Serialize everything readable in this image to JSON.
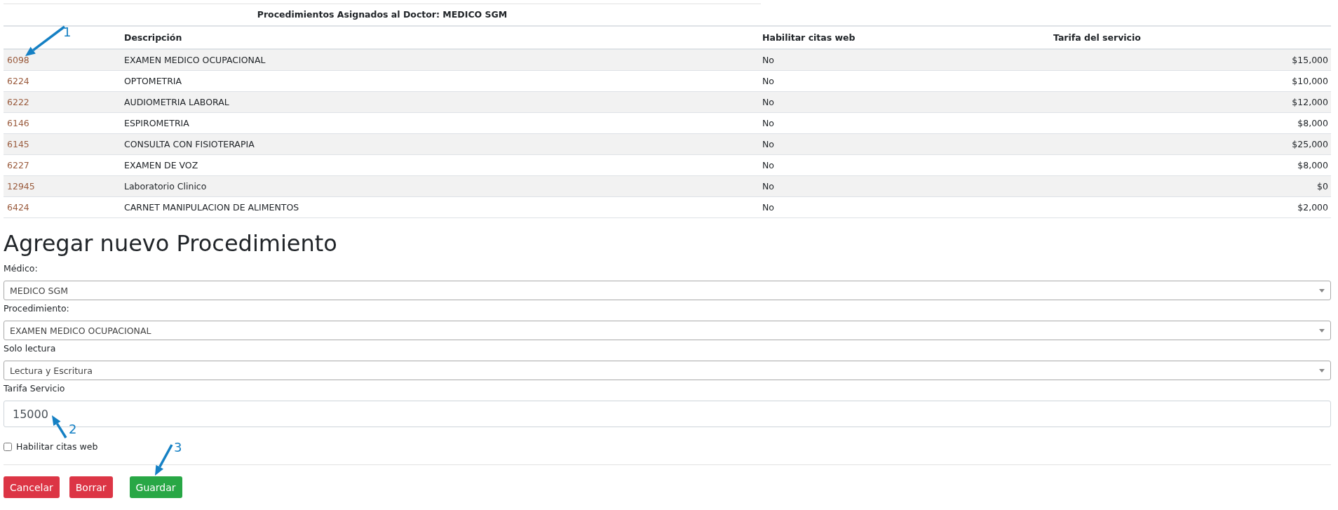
{
  "table": {
    "title": "Procedimientos Asignados al Doctor: MEDICO SGM",
    "columns": [
      "Descripción",
      "Habilitar citas web",
      "Tarifa del servicio"
    ],
    "rows": [
      {
        "code": "6098",
        "description": "EXAMEN MEDICO OCUPACIONAL",
        "web": "No",
        "fee": "$15,000"
      },
      {
        "code": "6224",
        "description": "OPTOMETRIA",
        "web": "No",
        "fee": "$10,000"
      },
      {
        "code": "6222",
        "description": "AUDIOMETRIA LABORAL",
        "web": "No",
        "fee": "$12,000"
      },
      {
        "code": "6146",
        "description": "ESPIROMETRIA",
        "web": "No",
        "fee": "$8,000"
      },
      {
        "code": "6145",
        "description": "CONSULTA CON FISIOTERAPIA",
        "web": "No",
        "fee": "$25,000"
      },
      {
        "code": "6227",
        "description": "EXAMEN DE VOZ",
        "web": "No",
        "fee": "$8,000"
      },
      {
        "code": "12945",
        "description": "Laboratorio Clinico",
        "web": "No",
        "fee": "$0"
      },
      {
        "code": "6424",
        "description": "CARNET MANIPULACION DE ALIMENTOS",
        "web": "No",
        "fee": "$2,000"
      }
    ]
  },
  "form": {
    "heading": "Agregar nuevo Procedimiento",
    "fields": [
      {
        "kind": "select",
        "label": "Médico:",
        "value": "MEDICO SGM"
      },
      {
        "kind": "select",
        "label": "Procedimiento:",
        "value": "EXAMEN MEDICO OCUPACIONAL"
      },
      {
        "kind": "select",
        "label": "Solo lectura",
        "value": "Lectura y Escritura"
      },
      {
        "kind": "input",
        "label": "Tarifa Servicio",
        "value": "15000"
      }
    ],
    "checkbox": {
      "label": "Habilitar citas web",
      "checked": false
    },
    "buttons": [
      {
        "label": "Cancelar",
        "kind": "danger"
      },
      {
        "label": "Borrar",
        "kind": "danger"
      },
      {
        "label": "Guardar",
        "kind": "success"
      }
    ]
  },
  "annotations": [
    {
      "label": "1"
    },
    {
      "label": "2"
    },
    {
      "label": "3"
    }
  ]
}
